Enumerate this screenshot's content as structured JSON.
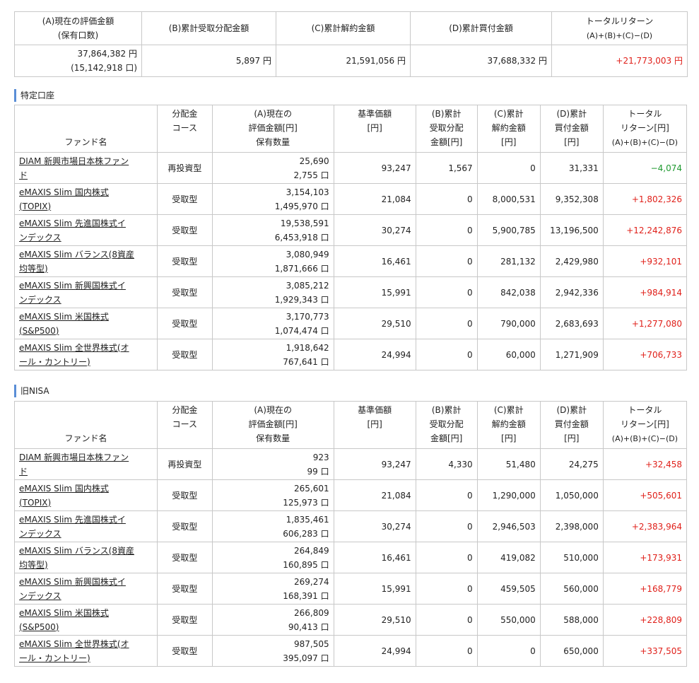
{
  "summary": {
    "headers": {
      "a_line1": "(A)現在の評価金額",
      "a_line2": "(保有口数)",
      "b": "(B)累計受取分配金額",
      "c": "(C)累計解約金額",
      "d": "(D)累計買付金額",
      "total_line1": "トータルリターン",
      "total_line2": "(A)+(B)+(C)−(D)"
    },
    "values": {
      "a_amount": "37,864,382 円",
      "a_units": "(15,142,918 口)",
      "b": "5,897 円",
      "c": "21,591,056 円",
      "d": "37,688,332 円",
      "total": "+21,773,003 円"
    }
  },
  "tokutei": {
    "title": "特定口座",
    "headers": {
      "fund": "ファンド名",
      "course1": "分配金",
      "course2": "コース",
      "a1": "(A)現在の",
      "a2": "評価金額[円]",
      "a3": "保有数量",
      "base1": "基準価額",
      "base2": "[円]",
      "b1": "(B)累計",
      "b2": "受取分配",
      "b3": "金額[円]",
      "c1": "(C)累計",
      "c2": "解約金額",
      "c3": "[円]",
      "d1": "(D)累計",
      "d2": "買付金額",
      "d3": "[円]",
      "t1": "トータル",
      "t2": "リターン[円]",
      "t3": "(A)+(B)+(C)−(D)"
    },
    "rows": [
      {
        "name1": "DIAM 新興市場日本株ファン",
        "name2": "ド",
        "course": "再投資型",
        "amount": "25,690",
        "units": "2,755 口",
        "base": "93,247",
        "b": "1,567",
        "c": "0",
        "d": "31,331",
        "total": "−4,074",
        "sign": "neg"
      },
      {
        "name1": "eMAXIS Slim 国内株式",
        "name2": "(TOPIX)",
        "course": "受取型",
        "amount": "3,154,103",
        "units": "1,495,970 口",
        "base": "21,084",
        "b": "0",
        "c": "8,000,531",
        "d": "9,352,308",
        "total": "+1,802,326",
        "sign": "pos"
      },
      {
        "name1": "eMAXIS Slim 先進国株式イ",
        "name2": "ンデックス",
        "course": "受取型",
        "amount": "19,538,591",
        "units": "6,453,918 口",
        "base": "30,274",
        "b": "0",
        "c": "5,900,785",
        "d": "13,196,500",
        "total": "+12,242,876",
        "sign": "pos"
      },
      {
        "name1": "eMAXIS Slim バランス(8資産",
        "name2": "均等型)",
        "course": "受取型",
        "amount": "3,080,949",
        "units": "1,871,666 口",
        "base": "16,461",
        "b": "0",
        "c": "281,132",
        "d": "2,429,980",
        "total": "+932,101",
        "sign": "pos"
      },
      {
        "name1": "eMAXIS Slim 新興国株式イ",
        "name2": "ンデックス",
        "course": "受取型",
        "amount": "3,085,212",
        "units": "1,929,343 口",
        "base": "15,991",
        "b": "0",
        "c": "842,038",
        "d": "2,942,336",
        "total": "+984,914",
        "sign": "pos"
      },
      {
        "name1": "eMAXIS Slim 米国株式",
        "name2": "(S&P500)",
        "course": "受取型",
        "amount": "3,170,773",
        "units": "1,074,474 口",
        "base": "29,510",
        "b": "0",
        "c": "790,000",
        "d": "2,683,693",
        "total": "+1,277,080",
        "sign": "pos"
      },
      {
        "name1": "eMAXIS Slim 全世界株式(オ",
        "name2": "ール・カントリー)",
        "course": "受取型",
        "amount": "1,918,642",
        "units": "767,641 口",
        "base": "24,994",
        "b": "0",
        "c": "60,000",
        "d": "1,271,909",
        "total": "+706,733",
        "sign": "pos"
      }
    ]
  },
  "nisa": {
    "title": "旧NISA",
    "rows": [
      {
        "name1": "DIAM 新興市場日本株ファン",
        "name2": "ド",
        "course": "再投資型",
        "amount": "923",
        "units": "99 口",
        "base": "93,247",
        "b": "4,330",
        "c": "51,480",
        "d": "24,275",
        "total": "+32,458",
        "sign": "pos"
      },
      {
        "name1": "eMAXIS Slim 国内株式",
        "name2": "(TOPIX)",
        "course": "受取型",
        "amount": "265,601",
        "units": "125,973 口",
        "base": "21,084",
        "b": "0",
        "c": "1,290,000",
        "d": "1,050,000",
        "total": "+505,601",
        "sign": "pos"
      },
      {
        "name1": "eMAXIS Slim 先進国株式イ",
        "name2": "ンデックス",
        "course": "受取型",
        "amount": "1,835,461",
        "units": "606,283 口",
        "base": "30,274",
        "b": "0",
        "c": "2,946,503",
        "d": "2,398,000",
        "total": "+2,383,964",
        "sign": "pos"
      },
      {
        "name1": "eMAXIS Slim バランス(8資産",
        "name2": "均等型)",
        "course": "受取型",
        "amount": "264,849",
        "units": "160,895 口",
        "base": "16,461",
        "b": "0",
        "c": "419,082",
        "d": "510,000",
        "total": "+173,931",
        "sign": "pos"
      },
      {
        "name1": "eMAXIS Slim 新興国株式イ",
        "name2": "ンデックス",
        "course": "受取型",
        "amount": "269,274",
        "units": "168,391 口",
        "base": "15,991",
        "b": "0",
        "c": "459,505",
        "d": "560,000",
        "total": "+168,779",
        "sign": "pos"
      },
      {
        "name1": "eMAXIS Slim 米国株式",
        "name2": "(S&P500)",
        "course": "受取型",
        "amount": "266,809",
        "units": "90,413 口",
        "base": "29,510",
        "b": "0",
        "c": "550,000",
        "d": "588,000",
        "total": "+228,809",
        "sign": "pos"
      },
      {
        "name1": "eMAXIS Slim 全世界株式(オ",
        "name2": "ール・カントリー)",
        "course": "受取型",
        "amount": "987,505",
        "units": "395,097 口",
        "base": "24,994",
        "b": "0",
        "c": "0",
        "d": "650,000",
        "total": "+337,505",
        "sign": "pos"
      }
    ]
  },
  "colors": {
    "positive": "#e0201a",
    "negative": "#1f9a30",
    "section_bar": "#5a8ed6"
  }
}
